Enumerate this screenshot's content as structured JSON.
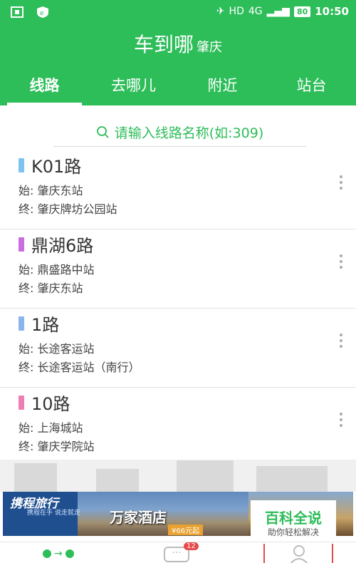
{
  "status": {
    "hd_label": "HD",
    "net_label": "4G",
    "battery": "80",
    "time": "10:50"
  },
  "header": {
    "title": "车到哪",
    "city": "肇庆"
  },
  "tabs": [
    {
      "label": "线路",
      "active": true
    },
    {
      "label": "去哪儿",
      "active": false
    },
    {
      "label": "附近",
      "active": false
    },
    {
      "label": "站台",
      "active": false
    }
  ],
  "search": {
    "placeholder": "请输入线路名称(如:309)"
  },
  "routes": [
    {
      "name": "K01路",
      "start": "始: 肇庆东站",
      "end": "终: 肇庆牌坊公园站",
      "color": "#7cc4f0"
    },
    {
      "name": "鼎湖6路",
      "start": "始: 鼎盛路中站",
      "end": "终: 肇庆东站",
      "color": "#c86ee0"
    },
    {
      "name": "1路",
      "start": "始: 长途客运站",
      "end": "终: 长途客运站（南行）",
      "color": "#8ab4ec"
    },
    {
      "name": "10路",
      "start": "始: 上海城站",
      "end": "终: 肇庆学院站",
      "color": "#ee7fb4"
    }
  ],
  "ad": {
    "brand": "携程旅行",
    "slogan": "携程在手 说走就走",
    "hotel": "万家酒店",
    "price": "¥66元起"
  },
  "watermark": {
    "title": "百科全说",
    "subtitle": "助你轻松解决"
  },
  "bottom_nav": {
    "msg_icon_text": "···",
    "badge": "12"
  },
  "colors": {
    "primary": "#2dbd59",
    "badge": "#e84a4a"
  }
}
